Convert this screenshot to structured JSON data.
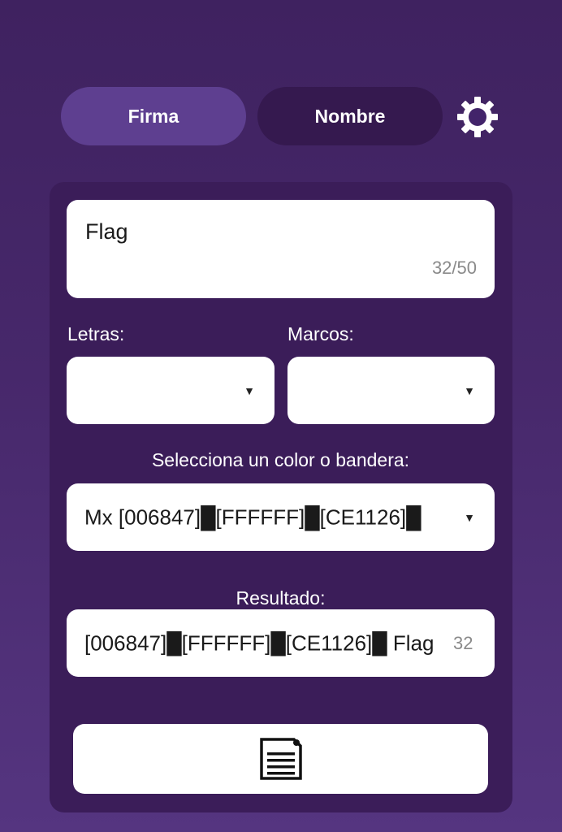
{
  "tabs": {
    "firma": "Firma",
    "nombre": "Nombre"
  },
  "icons": {
    "settings": "gear-icon",
    "copy": "document-icon"
  },
  "input": {
    "value": "Flag",
    "counter": "32/50"
  },
  "selectors": {
    "letras_label": "Letras:",
    "marcos_label": "Marcos:",
    "letras_value": "",
    "marcos_value": ""
  },
  "color": {
    "label": "Selecciona un color o bandera:",
    "value": "Mx [006847]█[FFFFFF]█[CE1126]█"
  },
  "result": {
    "label": "Resultado:",
    "value": "[006847]█[FFFFFF]█[CE1126]█ Flag",
    "count": "32"
  },
  "colors": {
    "background": "#45276a",
    "card": "#3b1d59",
    "tab_active": "#5e3f90",
    "tab_inactive": "#35194f"
  }
}
